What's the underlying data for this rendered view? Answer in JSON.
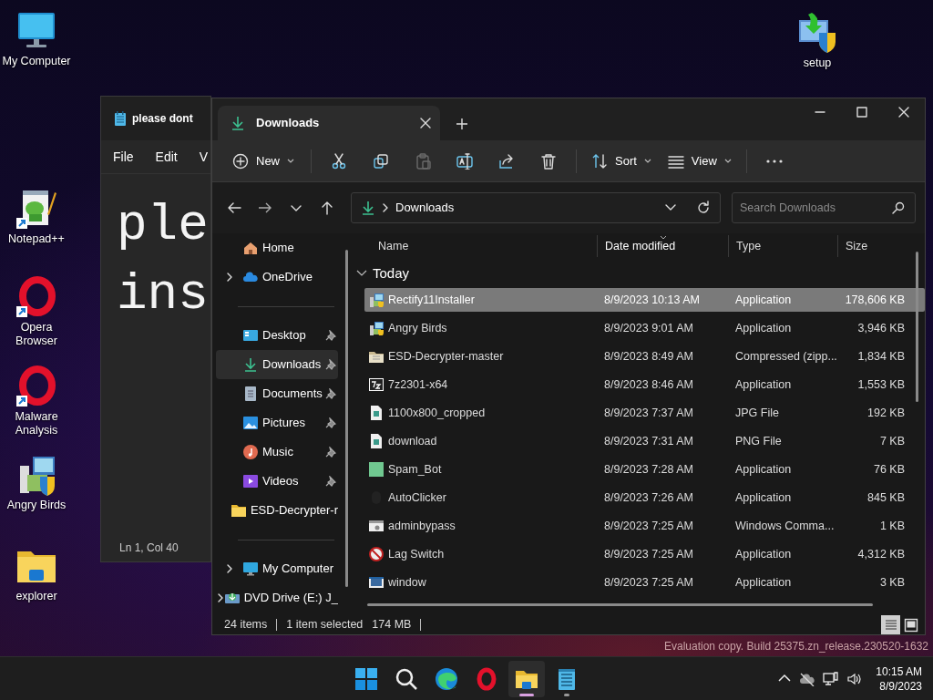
{
  "desktop": {
    "icons": [
      {
        "label": "My Computer",
        "kind": "computer",
        "shortcut": false
      },
      {
        "label": "Notepad++",
        "kind": "notepad",
        "shortcut": true
      },
      {
        "label": "Opera Browser",
        "kind": "opera",
        "shortcut": true
      },
      {
        "label": "Malware Analysis",
        "kind": "opera",
        "shortcut": true
      },
      {
        "label": "Angry Birds",
        "kind": "installer",
        "shortcut": false
      },
      {
        "label": "explorer",
        "kind": "folder",
        "shortcut": false
      },
      {
        "label": "setup",
        "kind": "setup",
        "shortcut": false
      }
    ]
  },
  "notepad": {
    "tab_title": "please dont",
    "menu": [
      "File",
      "Edit",
      "V"
    ],
    "text_lines": [
      "ple",
      "ins"
    ],
    "status": "Ln 1, Col 40"
  },
  "explorer": {
    "tab_title": "Downloads",
    "toolbar": [
      {
        "kind": "new",
        "label": "New",
        "disabled": false
      },
      {
        "kind": "cut",
        "disabled": false
      },
      {
        "kind": "copy",
        "disabled": false
      },
      {
        "kind": "paste",
        "disabled": true
      },
      {
        "kind": "rename",
        "disabled": false
      },
      {
        "kind": "share",
        "disabled": false
      },
      {
        "kind": "delete",
        "disabled": false
      },
      {
        "kind": "sort",
        "label": "Sort",
        "disabled": false
      },
      {
        "kind": "view",
        "label": "View",
        "disabled": false
      },
      {
        "kind": "more",
        "disabled": false
      }
    ],
    "address": {
      "path": "Downloads"
    },
    "search": {
      "placeholder": "Search Downloads"
    },
    "nav_groups": [
      {
        "items": [
          {
            "label": "Home",
            "kind": "home",
            "has_children": false,
            "pinned": false,
            "selected": false
          },
          {
            "label": "OneDrive",
            "kind": "cloud",
            "has_children": true,
            "pinned": false,
            "selected": false
          }
        ]
      },
      {
        "items": [
          {
            "label": "Desktop",
            "kind": "desktop",
            "has_children": false,
            "pinned": true,
            "selected": false
          },
          {
            "label": "Downloads",
            "kind": "downloads",
            "has_children": false,
            "pinned": true,
            "selected": true
          },
          {
            "label": "Documents",
            "kind": "documents",
            "has_children": false,
            "pinned": true,
            "selected": false
          },
          {
            "label": "Pictures",
            "kind": "pictures",
            "has_children": false,
            "pinned": true,
            "selected": false
          },
          {
            "label": "Music",
            "kind": "music",
            "has_children": false,
            "pinned": true,
            "selected": false
          },
          {
            "label": "Videos",
            "kind": "videos",
            "has_children": false,
            "pinned": true,
            "selected": false
          },
          {
            "label": "ESD-Decrypter-r",
            "kind": "folder",
            "has_children": false,
            "pinned": false,
            "selected": false
          }
        ]
      },
      {
        "items": [
          {
            "label": "My Computer",
            "kind": "computer",
            "has_children": true,
            "pinned": false,
            "selected": false
          },
          {
            "label": "DVD Drive (E:) J_",
            "kind": "dvd",
            "has_children": true,
            "pinned": false,
            "selected": false
          }
        ]
      }
    ],
    "columns": [
      {
        "label": "Name",
        "sorted": false
      },
      {
        "label": "Date modified",
        "sorted": true
      },
      {
        "label": "Type",
        "sorted": false
      },
      {
        "label": "Size",
        "sorted": false
      }
    ],
    "group": {
      "label": "Today",
      "expanded": true
    },
    "rows": [
      {
        "name": "Rectify11Installer",
        "date": "8/9/2023 10:13 AM",
        "type": "Application",
        "size": "178,606 KB",
        "kind": "installer",
        "selected": true
      },
      {
        "name": "Angry Birds",
        "date": "8/9/2023 9:01 AM",
        "type": "Application",
        "size": "3,946 KB",
        "kind": "installer",
        "selected": false
      },
      {
        "name": "ESD-Decrypter-master",
        "date": "8/9/2023 8:49 AM",
        "type": "Compressed (zipp...",
        "size": "1,834 KB",
        "kind": "zip",
        "selected": false
      },
      {
        "name": "7z2301-x64",
        "date": "8/9/2023 8:46 AM",
        "type": "Application",
        "size": "1,553 KB",
        "kind": "archiver",
        "selected": false
      },
      {
        "name": "1100x800_cropped",
        "date": "8/9/2023 7:37 AM",
        "type": "JPG File",
        "size": "192 KB",
        "kind": "image",
        "selected": false
      },
      {
        "name": "download",
        "date": "8/9/2023 7:31 AM",
        "type": "PNG File",
        "size": "7 KB",
        "kind": "image",
        "selected": false
      },
      {
        "name": "Spam_Bot",
        "date": "8/9/2023 7:28 AM",
        "type": "Application",
        "size": "76 KB",
        "kind": "tile",
        "selected": false
      },
      {
        "name": "AutoClicker",
        "date": "8/9/2023 7:26 AM",
        "type": "Application",
        "size": "845 KB",
        "kind": "blank",
        "selected": false
      },
      {
        "name": "adminbypass",
        "date": "8/9/2023 7:25 AM",
        "type": "Windows Comma...",
        "size": "1 KB",
        "kind": "script",
        "selected": false
      },
      {
        "name": "Lag Switch",
        "date": "8/9/2023 7:25 AM",
        "type": "Application",
        "size": "4,312 KB",
        "kind": "blocked",
        "selected": false
      },
      {
        "name": "window",
        "date": "8/9/2023 7:25 AM",
        "type": "Application",
        "size": "3 KB",
        "kind": "app",
        "selected": false
      }
    ],
    "status": {
      "count": "24 items",
      "selection": "1 item selected",
      "size": "174 MB"
    },
    "view_modes": [
      {
        "kind": "details",
        "selected": true
      },
      {
        "kind": "tiles",
        "selected": false
      }
    ]
  },
  "build_notice": "Evaluation copy. Build 25375.zn_release.230520-1632",
  "taskbar": {
    "apps": [
      {
        "kind": "start",
        "running": false,
        "selected": false
      },
      {
        "kind": "search",
        "running": false,
        "selected": false
      },
      {
        "kind": "edge",
        "running": false,
        "selected": false
      },
      {
        "kind": "opera",
        "running": false,
        "selected": false
      },
      {
        "kind": "explorer",
        "running": true,
        "selected": true
      },
      {
        "kind": "notepad",
        "running": true,
        "selected": false
      }
    ],
    "clock": {
      "time": "10:15 AM",
      "date": "8/9/2023"
    }
  }
}
